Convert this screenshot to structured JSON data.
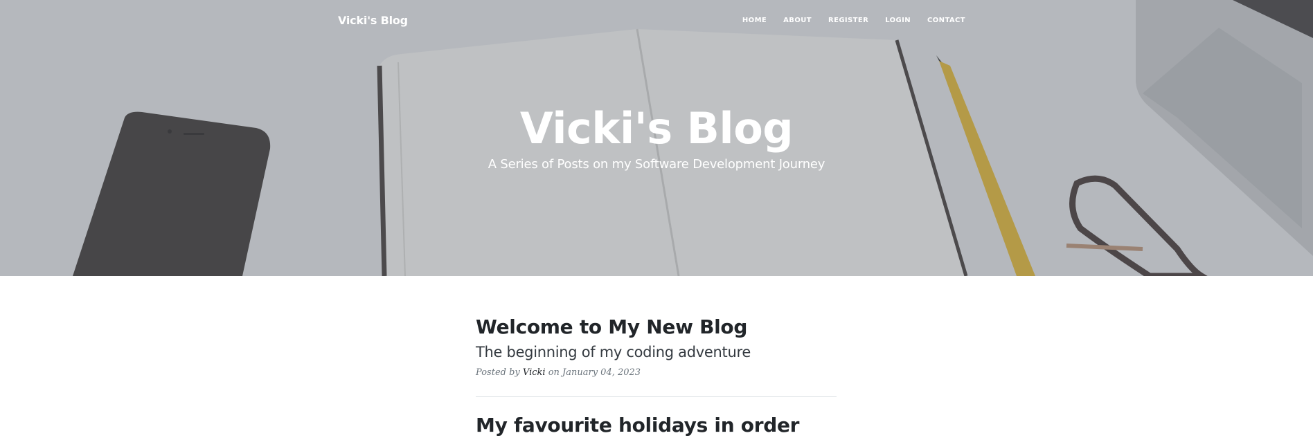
{
  "navbar": {
    "brand": "Vicki's Blog",
    "links": [
      {
        "label": "HOME"
      },
      {
        "label": "ABOUT"
      },
      {
        "label": "REGISTER"
      },
      {
        "label": "LOGIN"
      },
      {
        "label": "CONTACT"
      }
    ]
  },
  "header": {
    "title": "Vicki's Blog",
    "subtitle": "A Series of Posts on my Software Development Journey"
  },
  "posts": [
    {
      "title": "Welcome to My New Blog",
      "subtitle": "The beginning of my coding adventure",
      "meta_prefix": "Posted by",
      "author": "Vicki",
      "meta_on": "on",
      "date": "January 04, 2023"
    },
    {
      "title": "My favourite holidays in order"
    }
  ]
}
